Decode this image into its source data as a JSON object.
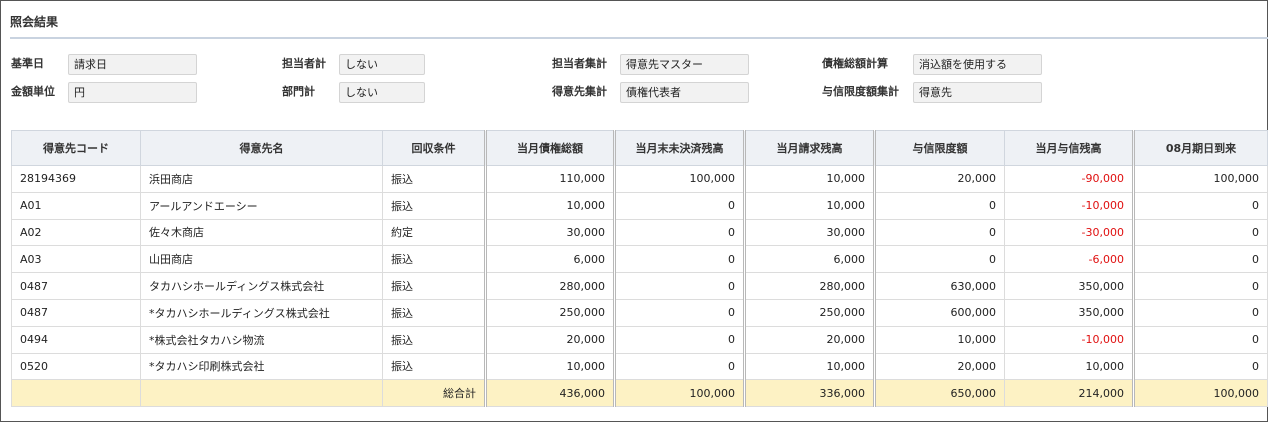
{
  "page": {
    "title": "照会結果"
  },
  "fields": [
    {
      "label": "基準日",
      "value": "請求日"
    },
    {
      "label": "担当者計",
      "value": "しない"
    },
    {
      "label": "担当者集計",
      "value": "得意先マスター"
    },
    {
      "label": "債権総額計算",
      "value": "消込額を使用する"
    },
    {
      "label": "金額単位",
      "value": "円"
    },
    {
      "label": "部門計",
      "value": "しない"
    },
    {
      "label": "得意先集計",
      "value": "債権代表者"
    },
    {
      "label": "与信限度額集計",
      "value": "得意先"
    }
  ],
  "table": {
    "columns": [
      "得意先コード",
      "得意先名",
      "回収条件",
      "当月債権総額",
      "当月末未決済残高",
      "当月請求残高",
      "与信限度額",
      "当月与信残高",
      "08月期日到来"
    ],
    "rows": [
      [
        "28194369",
        "浜田商店",
        "振込",
        "110,000",
        "100,000",
        "10,000",
        "20,000",
        "-90,000",
        "100,000"
      ],
      [
        "A01",
        "アールアンドエーシー",
        "振込",
        "10,000",
        "0",
        "10,000",
        "0",
        "-10,000",
        "0"
      ],
      [
        "A02",
        "佐々木商店",
        "約定",
        "30,000",
        "0",
        "30,000",
        "0",
        "-30,000",
        "0"
      ],
      [
        "A03",
        "山田商店",
        "振込",
        "6,000",
        "0",
        "6,000",
        "0",
        "-6,000",
        "0"
      ],
      [
        "0487",
        "タカハシホールディングス株式会社",
        "振込",
        "280,000",
        "0",
        "280,000",
        "630,000",
        "350,000",
        "0"
      ],
      [
        "0487",
        "*タカハシホールディングス株式会社",
        "振込",
        "250,000",
        "0",
        "250,000",
        "600,000",
        "350,000",
        "0"
      ],
      [
        "0494",
        "*株式会社タカハシ物流",
        "振込",
        "20,000",
        "0",
        "20,000",
        "10,000",
        "-10,000",
        "0"
      ],
      [
        "0520",
        "*タカハシ印刷株式会社",
        "振込",
        "10,000",
        "0",
        "10,000",
        "20,000",
        "10,000",
        "0"
      ]
    ],
    "total": [
      "",
      "",
      "総合計",
      "436,000",
      "100,000",
      "336,000",
      "650,000",
      "214,000",
      "100,000"
    ]
  },
  "colors": {
    "negative": "#e01010",
    "total_bg": "#fdf2c4",
    "header_bg": "#eef1f5"
  }
}
